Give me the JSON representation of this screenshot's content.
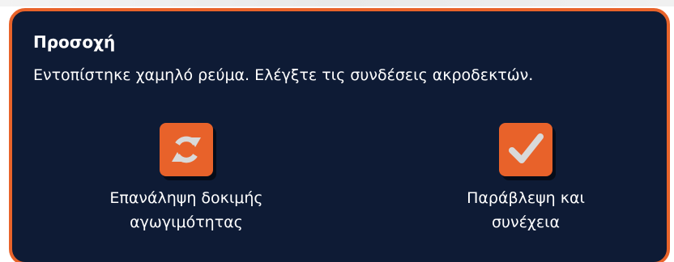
{
  "colors": {
    "dialog_background": "#0e1b35",
    "dialog_border": "#e8632a",
    "icon_tile": "#e8622a",
    "icon_glyph": "#d9d9d9",
    "text": "#ffffff"
  },
  "dialog": {
    "title": "Προσοχή",
    "message": "Εντοπίστηκε χαμηλό ρεύμα. Ελέγξτε τις συνδέσεις ακροδεκτών."
  },
  "actions": [
    {
      "icon": "refresh-icon",
      "label_line1": "Επανάληψη δοκιμής",
      "label_line2": "αγωγιμότητας"
    },
    {
      "icon": "checkmark-icon",
      "label_line1": "Παράβλεψη και",
      "label_line2": "συνέχεια"
    }
  ]
}
